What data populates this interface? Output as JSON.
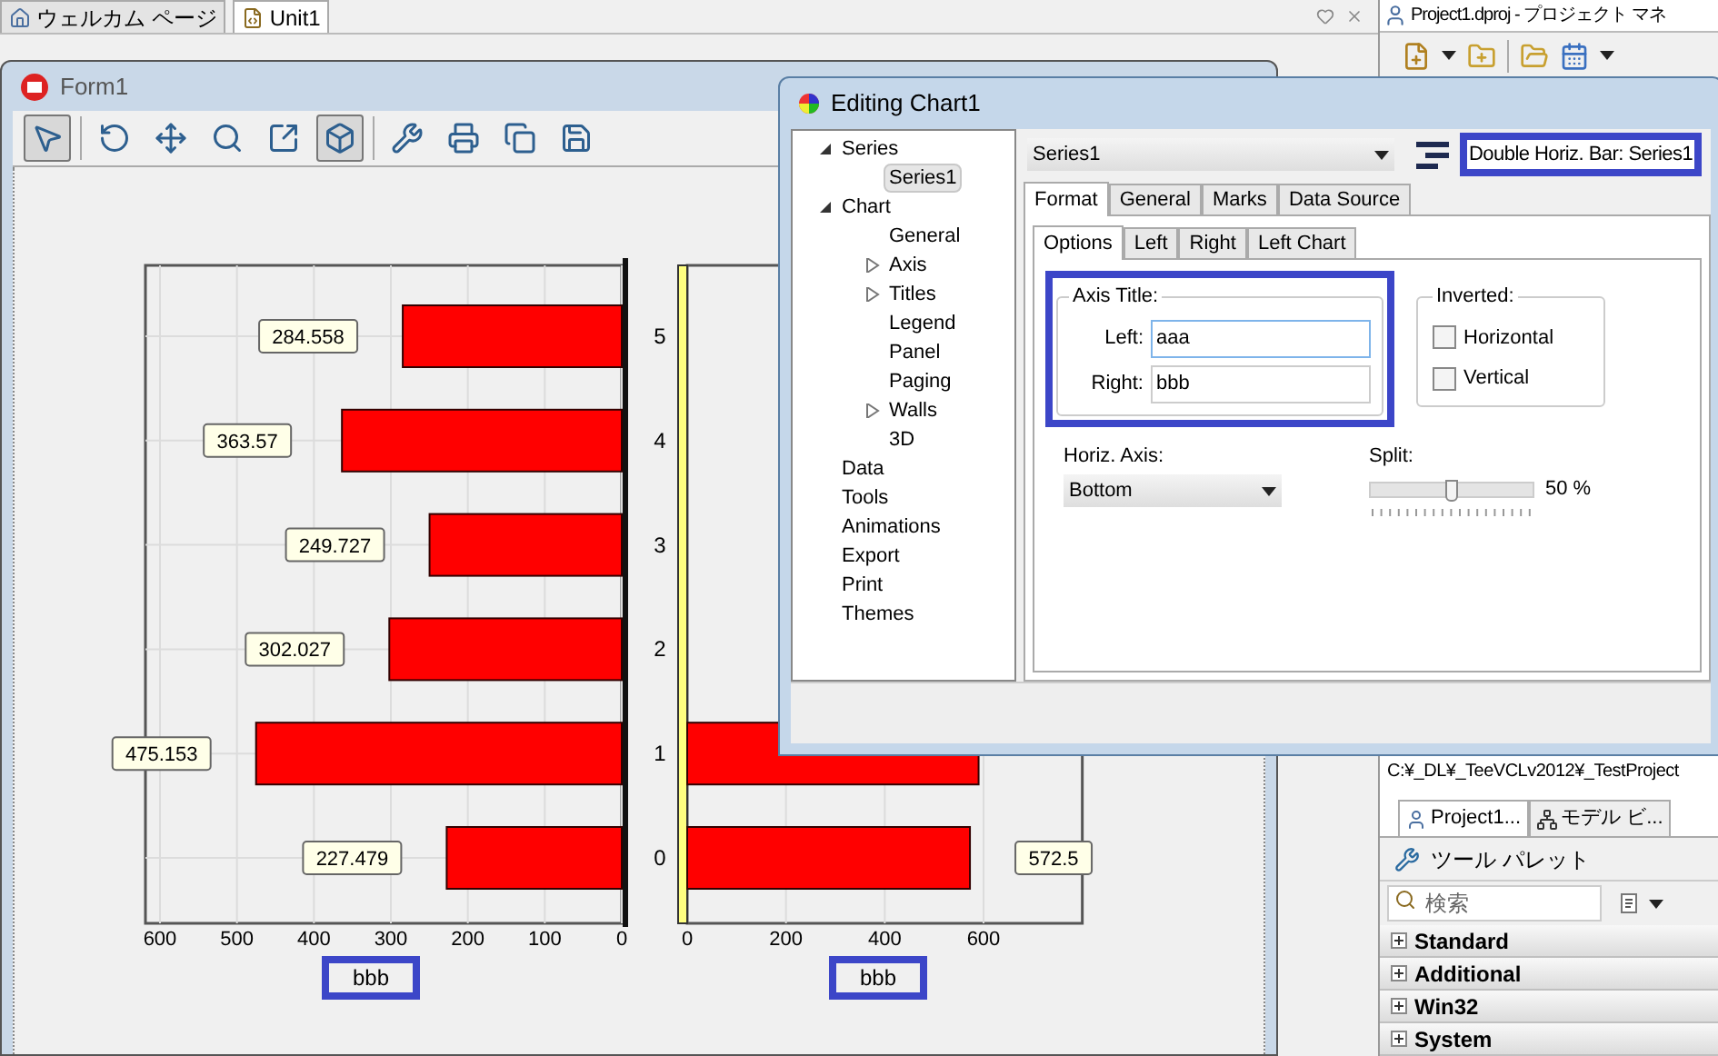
{
  "editor_tabs": [
    {
      "label": "ウェルカム ページ",
      "selected": false
    },
    {
      "label": "Unit1",
      "selected": true
    }
  ],
  "form": {
    "title": "Form1",
    "toolbar": [
      {
        "selected": true
      },
      {
        "selected": false
      },
      {
        "selected": false
      },
      {
        "selected": false
      },
      {
        "selected": false
      },
      {
        "selected": true
      },
      {
        "selected": false
      },
      {
        "selected": false
      },
      {
        "selected": false
      },
      {
        "selected": false
      }
    ],
    "charts": [
      {
        "chart_data": {
          "type": "bar",
          "orientation": "horizontal",
          "grid": true,
          "categories": [
            "5",
            "4",
            "3",
            "2",
            "1",
            "0"
          ],
          "series": [
            {
              "color": "#ff0000",
              "values": [
                284.558,
                363.57,
                249.727,
                302.027,
                475.153,
                227.479
              ]
            }
          ],
          "xlim": [
            600,
            0
          ],
          "xticks": [
            600,
            500,
            400,
            300,
            200,
            100,
            0
          ],
          "value_labels": [
            "284.558",
            "363.57",
            "249.727",
            "302.027",
            "475.153",
            "227.479"
          ],
          "xlabel": "bbb"
        }
      },
      {
        "chart_data": {
          "type": "bar",
          "orientation": "horizontal",
          "grid": true,
          "series": [
            {
              "color": "#ff0000",
              "values": [
                null,
                null,
                null,
                null,
                590,
                572.5
              ]
            }
          ],
          "xlim": [
            0,
            800
          ],
          "xticks": [
            0,
            200,
            400,
            600
          ],
          "value_labels": [
            null,
            null,
            null,
            null,
            null,
            "572.5"
          ],
          "xlabel": "bbb"
        }
      }
    ]
  },
  "dialog": {
    "title": "Editing Chart1",
    "tree": [
      {
        "label": "Series",
        "expanded": true,
        "children": [
          {
            "label": "Series1",
            "selected": true
          }
        ]
      },
      {
        "label": "Chart",
        "expanded": true,
        "children": [
          {
            "label": "General",
            "selected": false
          },
          {
            "label": "Axis",
            "expanded": false,
            "selected": false
          },
          {
            "label": "Titles",
            "expanded": false,
            "selected": false
          },
          {
            "label": "Legend",
            "selected": false
          },
          {
            "label": "Panel",
            "selected": false
          },
          {
            "label": "Paging",
            "selected": false
          },
          {
            "label": "Walls",
            "expanded": false,
            "selected": false
          },
          {
            "label": "3D",
            "selected": false
          }
        ]
      },
      {
        "label": "Data",
        "selected": false
      },
      {
        "label": "Tools",
        "selected": false
      },
      {
        "label": "Animations",
        "selected": false
      },
      {
        "label": "Export",
        "selected": false
      },
      {
        "label": "Print",
        "selected": false
      },
      {
        "label": "Themes",
        "selected": false
      }
    ],
    "series_select": {
      "value": "Series1"
    },
    "series_type": "Double Horiz. Bar: Series1",
    "tabs": [
      {
        "label": "Format",
        "selected": true
      },
      {
        "label": "General",
        "selected": false
      },
      {
        "label": "Marks",
        "selected": false
      },
      {
        "label": "Data Source",
        "selected": false
      }
    ],
    "subtabs": [
      {
        "label": "Options",
        "selected": true
      },
      {
        "label": "Left",
        "selected": false
      },
      {
        "label": "Right",
        "selected": false
      },
      {
        "label": "Left Chart",
        "selected": false
      }
    ],
    "axis_title": {
      "label": "Axis Title:",
      "fields": [
        {
          "label": "Left:",
          "value": "aaa"
        },
        {
          "label": "Right:",
          "value": "bbb"
        }
      ]
    },
    "inverted": {
      "label": "Inverted:",
      "options": [
        {
          "label": "Horizontal",
          "checked": false
        },
        {
          "label": "Vertical",
          "checked": false
        }
      ]
    },
    "horiz_axis": {
      "label": "Horiz. Axis:",
      "value": "Bottom"
    },
    "split": {
      "label": "Split:",
      "level": 0.5,
      "reading": "50 %"
    }
  },
  "project": {
    "title": "Project1.dproj - プロジェクト マネ",
    "path": "C:¥_DL¥_TeeVCLv2012¥_TestProject",
    "tabs": [
      {
        "label": "Project1...",
        "selected": true
      },
      {
        "label": "モデル ビ...",
        "selected": false
      }
    ],
    "palette": {
      "title": "ツール パレット",
      "search_placeholder": "検索",
      "categories": [
        "Standard",
        "Additional",
        "Win32",
        "System"
      ]
    }
  }
}
